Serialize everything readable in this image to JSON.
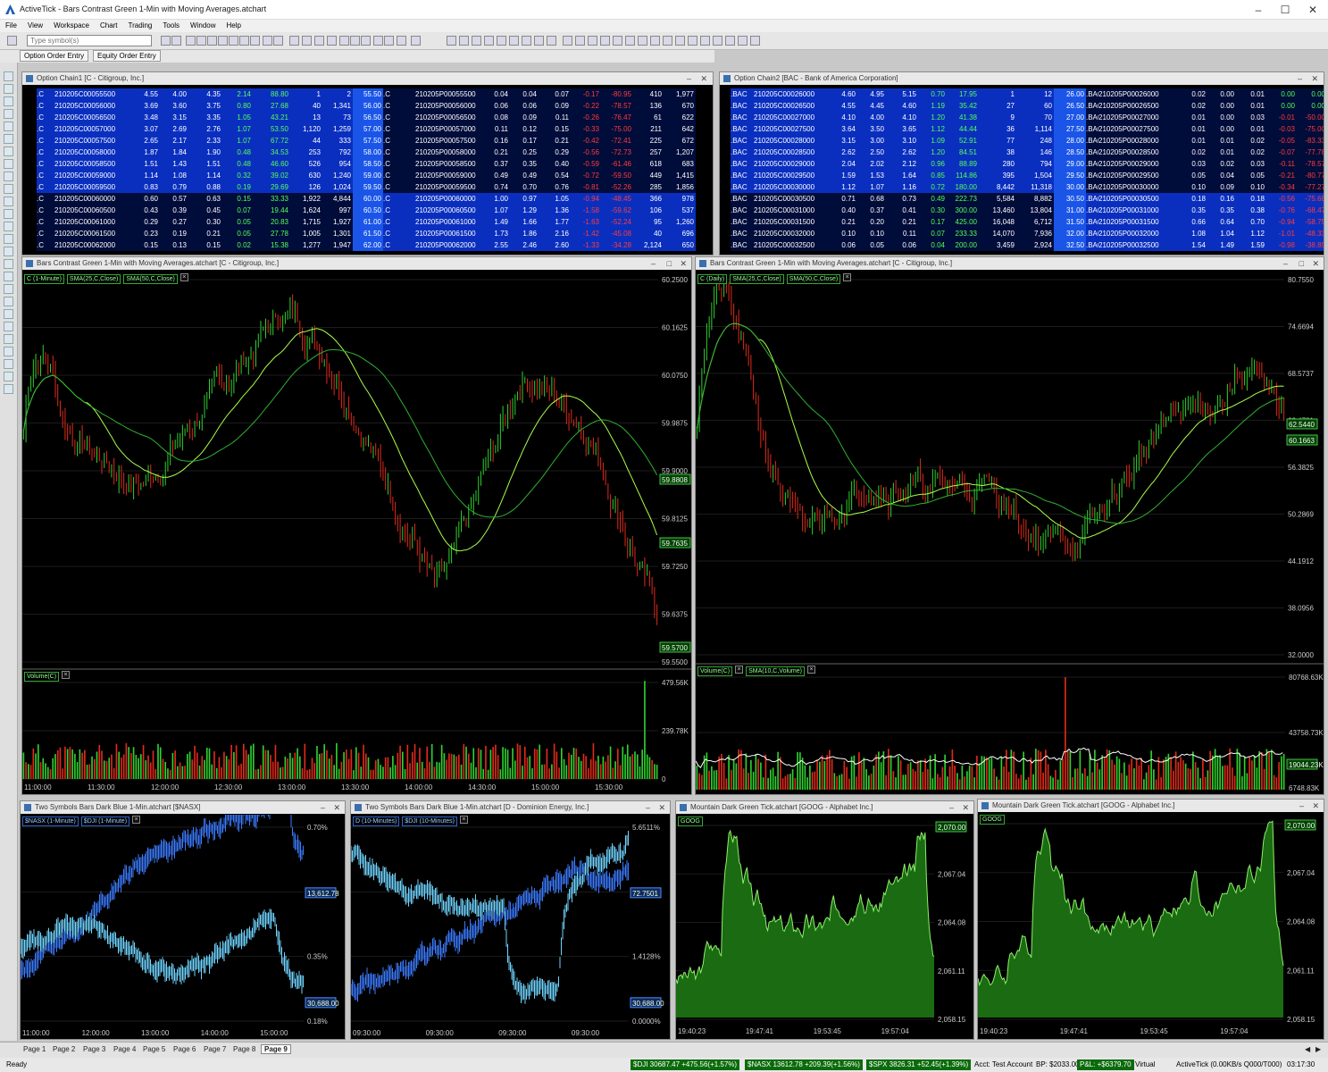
{
  "app": {
    "title": "ActiveTick - Bars Contrast Green 1-Min with Moving Averages.atchart",
    "menu": [
      "File",
      "View",
      "Workspace",
      "Chart",
      "Trading",
      "Tools",
      "Window",
      "Help"
    ],
    "symbol_placeholder": "Type symbol(s)",
    "order_tabs": [
      "Option Order Entry",
      "Equity Order Entry"
    ]
  },
  "chain1": {
    "title": "Option Chain1 [C - Citigroup, Inc.]",
    "rows": [
      [
        ".C",
        "210205C00055500",
        "4.55",
        "4.00",
        "4.35",
        "2.14",
        "88.80",
        "1",
        "2",
        "55.50",
        ".C",
        "210205P00055500",
        "0.04",
        "0.04",
        "0.07",
        "-0.17",
        "-80.95",
        "410",
        "1,977"
      ],
      [
        ".C",
        "210205C00056000",
        "3.69",
        "3.60",
        "3.75",
        "0.80",
        "27.68",
        "40",
        "1,341",
        "56.00",
        ".C",
        "210205P00056000",
        "0.06",
        "0.06",
        "0.09",
        "-0.22",
        "-78.57",
        "136",
        "670"
      ],
      [
        ".C",
        "210205C00056500",
        "3.48",
        "3.15",
        "3.35",
        "1.05",
        "43.21",
        "13",
        "73",
        "56.50",
        ".C",
        "210205P00056500",
        "0.08",
        "0.09",
        "0.11",
        "-0.26",
        "-76.47",
        "61",
        "622"
      ],
      [
        ".C",
        "210205C00057000",
        "3.07",
        "2.69",
        "2.76",
        "1.07",
        "53.50",
        "1,120",
        "1,259",
        "57.00",
        ".C",
        "210205P00057000",
        "0.11",
        "0.12",
        "0.15",
        "-0.33",
        "-75.00",
        "211",
        "642"
      ],
      [
        ".C",
        "210205C00057500",
        "2.65",
        "2.17",
        "2.33",
        "1.07",
        "67.72",
        "44",
        "333",
        "57.50",
        ".C",
        "210205P00057500",
        "0.16",
        "0.17",
        "0.21",
        "-0.42",
        "-72.41",
        "225",
        "672"
      ],
      [
        ".C",
        "210205C00058000",
        "1.87",
        "1.84",
        "1.90",
        "0.48",
        "34.53",
        "253",
        "792",
        "58.00",
        ".C",
        "210205P00058000",
        "0.21",
        "0.25",
        "0.29",
        "-0.56",
        "-72.73",
        "257",
        "1,207"
      ],
      [
        ".C",
        "210205C00058500",
        "1.51",
        "1.43",
        "1.51",
        "0.48",
        "46.60",
        "526",
        "954",
        "58.50",
        ".C",
        "210205P00058500",
        "0.37",
        "0.35",
        "0.40",
        "-0.59",
        "-61.46",
        "618",
        "683"
      ],
      [
        ".C",
        "210205C00059000",
        "1.14",
        "1.08",
        "1.14",
        "0.32",
        "39.02",
        "630",
        "1,240",
        "59.00",
        ".C",
        "210205P00059000",
        "0.49",
        "0.49",
        "0.54",
        "-0.72",
        "-59.50",
        "449",
        "1,415"
      ],
      [
        ".C",
        "210205C00059500",
        "0.83",
        "0.79",
        "0.88",
        "0.19",
        "29.69",
        "126",
        "1,024",
        "59.50",
        ".C",
        "210205P00059500",
        "0.74",
        "0.70",
        "0.76",
        "-0.81",
        "-52.26",
        "285",
        "1,856"
      ],
      [
        ".C",
        "210205C00060000",
        "0.60",
        "0.57",
        "0.63",
        "0.15",
        "33.33",
        "1,922",
        "4,844",
        "60.00",
        ".C",
        "210205P00060000",
        "1.00",
        "0.97",
        "1.05",
        "-0.94",
        "-48.45",
        "366",
        "978"
      ],
      [
        ".C",
        "210205C00060500",
        "0.43",
        "0.39",
        "0.45",
        "0.07",
        "19.44",
        "1,624",
        "997",
        "60.50",
        ".C",
        "210205P00060500",
        "1.07",
        "1.29",
        "1.36",
        "-1.58",
        "-59.62",
        "106",
        "537"
      ],
      [
        ".C",
        "210205C00061000",
        "0.29",
        "0.27",
        "0.30",
        "0.05",
        "20.83",
        "1,715",
        "1,927",
        "61.00",
        ".C",
        "210205P00061000",
        "1.49",
        "1.66",
        "1.77",
        "-1.63",
        "-52.24",
        "95",
        "1,260"
      ],
      [
        ".C",
        "210205C00061500",
        "0.23",
        "0.19",
        "0.21",
        "0.05",
        "27.78",
        "1,005",
        "1,301",
        "61.50",
        ".C",
        "210205P00061500",
        "1.73",
        "1.86",
        "2.16",
        "-1.42",
        "-45.08",
        "40",
        "696"
      ],
      [
        ".C",
        "210205C00062000",
        "0.15",
        "0.13",
        "0.15",
        "0.02",
        "15.38",
        "1,277",
        "1,947",
        "62.00",
        ".C",
        "210205P00062000",
        "2.55",
        "2.46",
        "2.60",
        "-1.33",
        "-34.28",
        "2,124",
        "650"
      ]
    ]
  },
  "chain2": {
    "title": "Option Chain2 [BAC - Bank of America Corporation]",
    "rows": [
      [
        ".BAC",
        "210205C00026000",
        "4.60",
        "4.95",
        "5.15",
        "0.70",
        "17.95",
        "1",
        "12",
        "26.00",
        ".BAC",
        "210205P00026000",
        "0.02",
        "0.00",
        "0.01",
        "0.00",
        "0.00"
      ],
      [
        ".BAC",
        "210205C00026500",
        "4.55",
        "4.45",
        "4.60",
        "1.19",
        "35.42",
        "27",
        "60",
        "26.50",
        ".BAC",
        "210205P00026500",
        "0.02",
        "0.00",
        "0.01",
        "0.00",
        "0.00"
      ],
      [
        ".BAC",
        "210205C00027000",
        "4.10",
        "4.00",
        "4.10",
        "1.20",
        "41.38",
        "9",
        "70",
        "27.00",
        ".BAC",
        "210205P00027000",
        "0.01",
        "0.00",
        "0.03",
        "-0.01",
        "-50.00"
      ],
      [
        ".BAC",
        "210205C00027500",
        "3.64",
        "3.50",
        "3.65",
        "1.12",
        "44.44",
        "36",
        "1,114",
        "27.50",
        ".BAC",
        "210205P00027500",
        "0.01",
        "0.00",
        "0.01",
        "-0.03",
        "-75.00"
      ],
      [
        ".BAC",
        "210205C00028000",
        "3.15",
        "3.00",
        "3.10",
        "1.09",
        "52.91",
        "77",
        "248",
        "28.00",
        ".BAC",
        "210205P00028000",
        "0.01",
        "0.01",
        "0.02",
        "-0.05",
        "-83.33"
      ],
      [
        ".BAC",
        "210205C00028500",
        "2.62",
        "2.50",
        "2.62",
        "1.20",
        "84.51",
        "38",
        "146",
        "28.50",
        ".BAC",
        "210205P00028500",
        "0.02",
        "0.01",
        "0.02",
        "-0.07",
        "-77.78"
      ],
      [
        ".BAC",
        "210205C00029000",
        "2.04",
        "2.02",
        "2.12",
        "0.96",
        "88.89",
        "280",
        "794",
        "29.00",
        ".BAC",
        "210205P00029000",
        "0.03",
        "0.02",
        "0.03",
        "-0.11",
        "-78.57"
      ],
      [
        ".BAC",
        "210205C00029500",
        "1.59",
        "1.53",
        "1.64",
        "0.85",
        "114.86",
        "395",
        "1,504",
        "29.50",
        ".BAC",
        "210205P00029500",
        "0.05",
        "0.04",
        "0.05",
        "-0.21",
        "-80.77"
      ],
      [
        ".BAC",
        "210205C00030000",
        "1.12",
        "1.07",
        "1.16",
        "0.72",
        "180.00",
        "8,442",
        "11,318",
        "30.00",
        ".BAC",
        "210205P00030000",
        "0.10",
        "0.09",
        "0.10",
        "-0.34",
        "-77.27"
      ],
      [
        ".BAC",
        "210205C00030500",
        "0.71",
        "0.68",
        "0.73",
        "0.49",
        "222.73",
        "5,584",
        "8,882",
        "30.50",
        ".BAC",
        "210205P00030500",
        "0.18",
        "0.16",
        "0.18",
        "-0.56",
        "-75.68"
      ],
      [
        ".BAC",
        "210205C00031000",
        "0.40",
        "0.37",
        "0.41",
        "0.30",
        "300.00",
        "13,460",
        "13,804",
        "31.00",
        ".BAC",
        "210205P00031000",
        "0.35",
        "0.35",
        "0.38",
        "-0.76",
        "-68.47"
      ],
      [
        ".BAC",
        "210205C00031500",
        "0.21",
        "0.20",
        "0.21",
        "0.17",
        "425.00",
        "16,048",
        "6,712",
        "31.50",
        ".BAC",
        "210205P00031500",
        "0.66",
        "0.64",
        "0.70",
        "-0.94",
        "-58.75"
      ],
      [
        ".BAC",
        "210205C00032000",
        "0.10",
        "0.10",
        "0.11",
        "0.07",
        "233.33",
        "14,070",
        "7,936",
        "32.00",
        ".BAC",
        "210205P00032000",
        "1.08",
        "1.04",
        "1.12",
        "-1.01",
        "-48.33"
      ],
      [
        ".BAC",
        "210205C00032500",
        "0.06",
        "0.05",
        "0.06",
        "0.04",
        "200.00",
        "3,459",
        "2,924",
        "32.50",
        ".BAC",
        "210205P00032500",
        "1.54",
        "1.49",
        "1.59",
        "-0.98",
        "-38.89"
      ]
    ]
  },
  "chart1": {
    "title": "Bars Contrast Green 1-Min with Moving Averages.atchart [C - Citigroup, Inc.]",
    "chips": [
      "C (1-Minute)",
      "SMA(25,C,Close)",
      "SMA(50,C,Close)"
    ],
    "yticks": [
      "60.2500",
      "60.1625",
      "60.0750",
      "59.9875",
      "59.9000",
      "59.8125",
      "59.7250",
      "59.6375",
      "59.5500"
    ],
    "tags": [
      "59.8808",
      "59.7635",
      "59.5700"
    ],
    "vol_chip": "Volume(C)",
    "vol_ticks": [
      "479.56K",
      "239.78K",
      "0"
    ],
    "xticks": [
      "11:00:00",
      "11:30:00",
      "12:00:00",
      "12:30:00",
      "13:00:00",
      "13:30:00",
      "14:00:00",
      "14:30:00",
      "15:00:00",
      "15:30:00"
    ]
  },
  "chart2": {
    "title": "Bars Contrast Green 1-Min with Moving Averages.atchart [C - Citigroup, Inc.]",
    "chips": [
      "C (Daily)",
      "SMA(25,C,Close)",
      "SMA(50,C,Close)"
    ],
    "yticks": [
      "80.7550",
      "74.6694",
      "68.5737",
      "62.4781",
      "56.3825",
      "50.2869",
      "44.1912",
      "38.0956",
      "32.0000"
    ],
    "tags": [
      "62.5440",
      "60.1663"
    ],
    "vol_chips": [
      "Volume(C)",
      "SMA(10,C,Volume)"
    ],
    "vol_ticks": [
      "80768.63K",
      "43758.73K",
      "6748.83K"
    ],
    "vol_tag": "19044.23K"
  },
  "chart3": {
    "title": "Two Symbols Bars Dark Blue 1-Min.atchart [$NASX]",
    "chips": [
      "$NASX (1-Minute)",
      "$DJI (1-Minute)"
    ],
    "yticks": [
      "0.70%",
      "0.53%",
      "0.35%",
      "0.18%"
    ],
    "tags": [
      "13,612.78",
      "30,688.00"
    ],
    "xticks": [
      "11:00:00",
      "12:00:00",
      "13:00:00",
      "14:00:00",
      "15:00:00"
    ]
  },
  "chart4": {
    "title": "Two Symbols Bars Dark Blue 1-Min.atchart [D - Dominion Energy, Inc.]",
    "chips": [
      "D (10-Minutes)",
      "$DJI (10-Minutes)"
    ],
    "yticks": [
      "5.6511%",
      "4.2384%",
      "1.4128%",
      "0.0000%"
    ],
    "tags": [
      "72.7501",
      "30,688.00"
    ],
    "xticks": [
      "09:30:00",
      "09:30:00",
      "09:30:00",
      "09:30:00"
    ]
  },
  "chart5": {
    "title": "Mountain Dark Green Tick.atchart [GOOG - Alphabet Inc.]",
    "chip": "GOOG",
    "yticks": [
      "2,070.00",
      "2,067.04",
      "2,064.08",
      "2,061.11",
      "2,058.15"
    ],
    "xticks": [
      "19:40:23",
      "19:47:41",
      "19:53:45",
      "19:57:04"
    ]
  },
  "chart6": {
    "title": "Mountain Dark Green Tick.atchart [GOOG - Alphabet Inc.]",
    "chip": "GOOG",
    "yticks": [
      "2,070.00",
      "2,067.04",
      "2,064.08",
      "2,061.11",
      "2,058.15"
    ],
    "xticks": [
      "19:40:23",
      "19:47:41",
      "19:53:45",
      "19:57:04"
    ]
  },
  "pages": [
    "Page 1",
    "Page 2",
    "Page 3",
    "Page 4",
    "Page 5",
    "Page 6",
    "Page 7",
    "Page 8",
    "Page 9"
  ],
  "status": {
    "ready": "Ready",
    "quotes": [
      "$DJI 30687.47 +475.56(+1.57%)",
      "$NASX 13612.78 +209.39(+1.56%)",
      "$SPX 3826.31 +52.45(+1.39%)"
    ],
    "account": "Acct: Test Account",
    "bp": "BP: $2033.00",
    "pnl": "P&L: +$6379.70",
    "mode": "Virtual",
    "conn": "ActiveTick (0.00KB/s Q000/T000)",
    "time": "03:17:30"
  },
  "colors": {
    "up": "#2fd12f",
    "down": "#e02a1a",
    "sma_fast": "#a8ff4a",
    "sma_slow": "#31b031",
    "mountain": "#1a6b12",
    "mountain_line": "#8df06a",
    "blue1": "#3b7bff",
    "blue2": "#6fd5ff",
    "cell_blue": "#0a2fbf",
    "cell_dark": "#000c3a"
  }
}
